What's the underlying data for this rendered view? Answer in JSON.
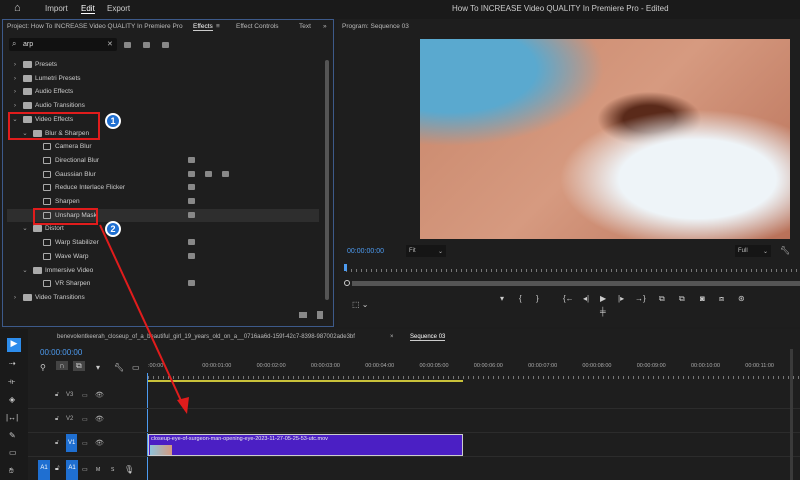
{
  "topbar": {
    "nav": [
      "Import",
      "Edit",
      "Export"
    ],
    "active": "Edit",
    "title": "How To INCREASE Video QUALITY In Premiere Pro",
    "status": "- Edited"
  },
  "left_panel": {
    "project_tab": "Project: How To INCREASE Video QUALITY In Premiere Pro",
    "tabs": [
      "Effects",
      "Effect Controls",
      "Text"
    ],
    "active_tab": "Effects",
    "search_value": "arp",
    "tree": [
      {
        "label": "Presets",
        "level": 0,
        "type": "preset",
        "expanded": false,
        "badges": 0
      },
      {
        "label": "Lumetri Presets",
        "level": 0,
        "type": "preset",
        "expanded": false,
        "badges": 0
      },
      {
        "label": "Audio Effects",
        "level": 0,
        "type": "folder",
        "expanded": false,
        "badges": 0
      },
      {
        "label": "Audio Transitions",
        "level": 0,
        "type": "folder",
        "expanded": false,
        "badges": 0
      },
      {
        "label": "Video Effects",
        "level": 0,
        "type": "folder",
        "expanded": true,
        "badges": 0
      },
      {
        "label": "Blur & Sharpen",
        "level": 1,
        "type": "folder",
        "expanded": true,
        "badges": 0
      },
      {
        "label": "Camera Blur",
        "level": 2,
        "type": "effect",
        "badges": 0
      },
      {
        "label": "Directional Blur",
        "level": 2,
        "type": "effect",
        "badges": 1
      },
      {
        "label": "Gaussian Blur",
        "level": 2,
        "type": "effect",
        "badges": 3
      },
      {
        "label": "Reduce Interlace Flicker",
        "level": 2,
        "type": "effect",
        "badges": 1
      },
      {
        "label": "Sharpen",
        "level": 2,
        "type": "effect",
        "badges": 1
      },
      {
        "label": "Unsharp Mask",
        "level": 2,
        "type": "effect",
        "badges": 1,
        "selected": true
      },
      {
        "label": "Distort",
        "level": 1,
        "type": "folder",
        "expanded": true,
        "badges": 0
      },
      {
        "label": "Warp Stabilizer",
        "level": 2,
        "type": "effect",
        "badges": 1
      },
      {
        "label": "Wave Warp",
        "level": 2,
        "type": "effect",
        "badges": 1
      },
      {
        "label": "Immersive Video",
        "level": 1,
        "type": "folder",
        "expanded": true,
        "badges": 0
      },
      {
        "label": "VR Sharpen",
        "level": 2,
        "type": "effect",
        "badges": 1
      },
      {
        "label": "Video Transitions",
        "level": 0,
        "type": "folder",
        "expanded": false,
        "badges": 0
      }
    ],
    "callouts": [
      "1",
      "2"
    ]
  },
  "program": {
    "title": "Program: Sequence 03",
    "timecode": "00:00:00:00",
    "zoom": "Fit",
    "resolution": "Full"
  },
  "timeline": {
    "tabs": [
      "benevolentkeerah_closeup_of_a_beautiful_girl_19_years_old_on_a__0716aa6d-159f-42c7-8398-987002ade3bf",
      "Sequence 03"
    ],
    "active_tab": "Sequence 03",
    "timecode": "00:00:00:00",
    "ruler": [
      ":00:00",
      "00:00:01:00",
      "00:00:02:00",
      "00:00:03:00",
      "00:00:04:00",
      "00:00:05:00",
      "00:00:06:00",
      "00:00:07:00",
      "00:00:08:00",
      "00:00:09:00",
      "00:00:10:00",
      "00:00:11:00"
    ],
    "tracks": [
      "V3",
      "V2",
      "V1"
    ],
    "audio_track": "A1",
    "source_patch": "A1",
    "audio_buttons": [
      "M",
      "S"
    ],
    "clip": "closeup-eye-of-surgeon-man-opening-eye-2023-11-27-05-25-53-utc.mov"
  },
  "colors": {
    "accent": "#2d8ceb",
    "clip": "#4b1fc4",
    "callout": "#e01c1c",
    "badge": "#1f6fd1"
  }
}
